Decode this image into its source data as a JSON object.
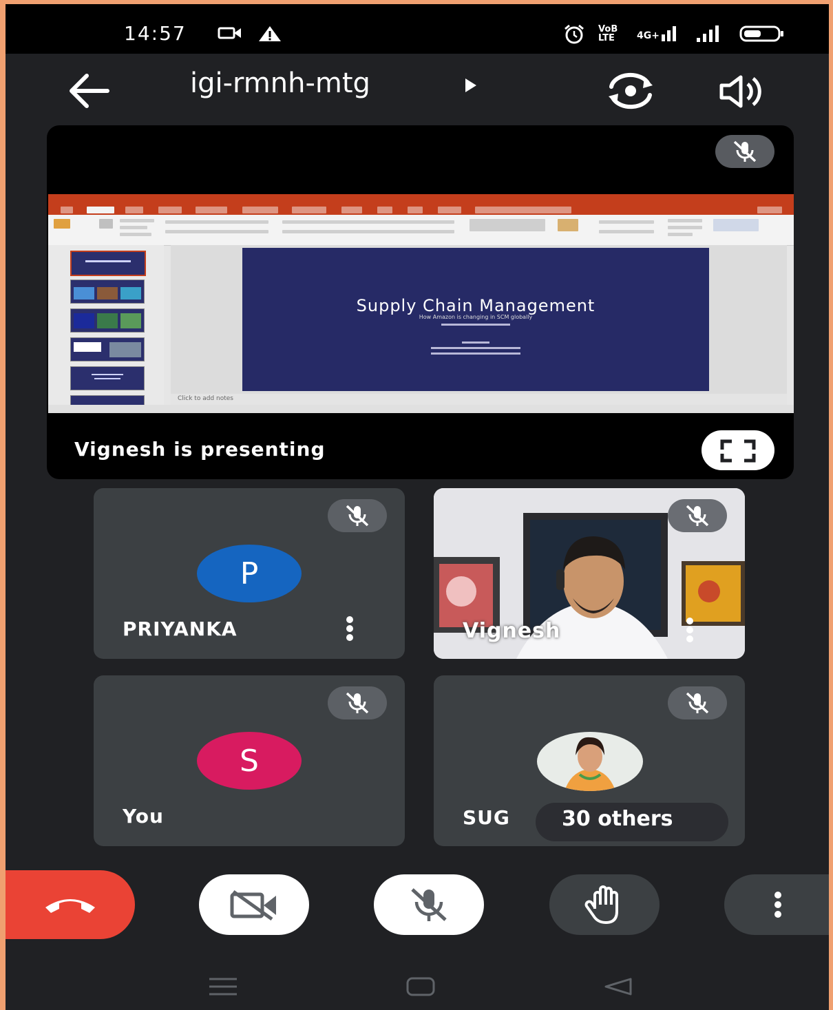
{
  "status_bar": {
    "time": "14:57",
    "left_icons": [
      "video-camera-icon",
      "warning-icon"
    ],
    "right_icons": [
      "alarm-icon",
      "volte-icon",
      "4g-signal-icon",
      "signal-icon",
      "battery-icon"
    ],
    "volte_label": "VoB LTE",
    "network_label": "4G+"
  },
  "header": {
    "meeting_code": "igi-rmnh-mtg",
    "icons": [
      "back-arrow-icon",
      "play-arrow-icon",
      "switch-camera-icon",
      "speaker-icon"
    ]
  },
  "presentation": {
    "label": "Vignesh is presenting",
    "slide": {
      "title": "Supply Chain Management",
      "subtitle": "How Amazon is changing in SCM globally"
    },
    "notes_placeholder": "Click to add notes",
    "icons": [
      "mic-off-icon",
      "fullscreen-icon"
    ]
  },
  "participants": [
    {
      "name": "PRIYANKA",
      "initial": "P",
      "avatar_color": "#1565c0",
      "muted": true
    },
    {
      "name": "Vignesh",
      "video": true,
      "muted": true
    },
    {
      "name": "You",
      "initial": "S",
      "avatar_color": "#d81b60",
      "muted": true
    },
    {
      "name": "SUG",
      "photo": true,
      "muted": true
    }
  ],
  "others": {
    "label": "30 others"
  },
  "controls": {
    "icons": [
      "end-call-icon",
      "camera-off-icon",
      "mic-off-icon",
      "raise-hand-icon",
      "more-options-icon"
    ],
    "colors": {
      "end_call": "#ea4335",
      "light": "#ffffff",
      "dark": "#3c4043"
    }
  },
  "nav_bar": {
    "icons": [
      "recents-icon",
      "home-icon",
      "back-icon"
    ]
  }
}
